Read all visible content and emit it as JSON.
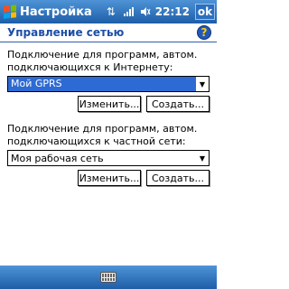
{
  "titlebar": {
    "title": "Настройка",
    "time": "22:12",
    "ok_label": "ok"
  },
  "header": {
    "title": "Управление сетью"
  },
  "internet": {
    "description": "Подключение для программ, автом. подключающихся к Интернету:",
    "selected": "Мой GPRS",
    "edit_label": "Изменить...",
    "create_label": "Создать..."
  },
  "private": {
    "description": "Подключение для программ, автом. подключающихся к частной сети:",
    "selected": "Моя рабочая сеть",
    "edit_label": "Изменить...",
    "create_label": "Создать..."
  },
  "colors": {
    "accent": "#1c4fa6",
    "titlebar": "#2c6fc0",
    "selection": "#2d6ad3"
  }
}
